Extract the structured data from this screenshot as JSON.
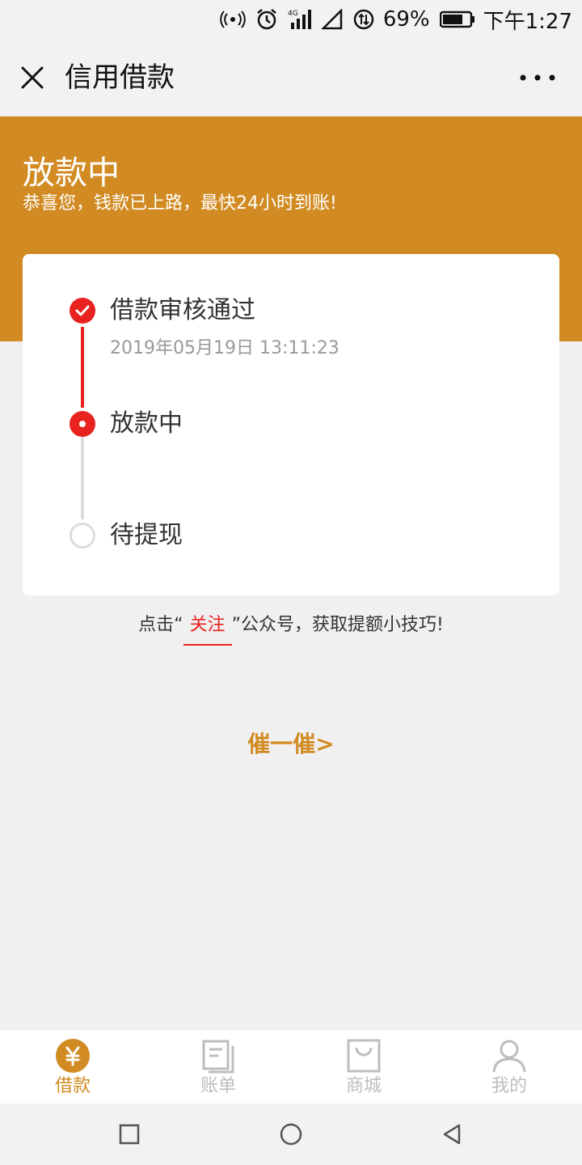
{
  "status_bar": {
    "battery_percent": "69%",
    "time": "下午1:27",
    "network": "4G",
    "icons": [
      "hotspot-icon",
      "alarm-icon",
      "signal-icon",
      "signal-empty-icon",
      "data-transfer-icon",
      "battery-icon"
    ]
  },
  "nav": {
    "title": "信用借款",
    "close_icon": "close-icon",
    "more_icon": "more-icon"
  },
  "banner": {
    "title": "放款中",
    "subtitle": "恭喜您，钱款已上路，最快24小时到账!"
  },
  "timeline": {
    "steps": [
      {
        "label": "借款审核通过",
        "time": "2019年05月19日 13:11:23",
        "state": "done"
      },
      {
        "label": "放款中",
        "state": "current"
      },
      {
        "label": "待提现",
        "state": "pending"
      }
    ],
    "colors": {
      "active": "#e8231f",
      "inactive": "#dcdcdc"
    }
  },
  "tip": {
    "prefix": "点击“",
    "link": "关注",
    "suffix": "”公众号，获取提额小技巧!"
  },
  "urge_button": "催一催>",
  "tabbar": {
    "items": [
      {
        "label": "借款",
        "icon": "yen-icon",
        "active": true
      },
      {
        "label": "账单",
        "icon": "bill-icon",
        "active": false
      },
      {
        "label": "商城",
        "icon": "shopping-bag-icon",
        "active": false
      },
      {
        "label": "我的",
        "icon": "user-icon",
        "active": false
      }
    ]
  },
  "colors": {
    "brand": "#d18b22",
    "accent": "#e8231f",
    "background": "#f0f0f0"
  }
}
